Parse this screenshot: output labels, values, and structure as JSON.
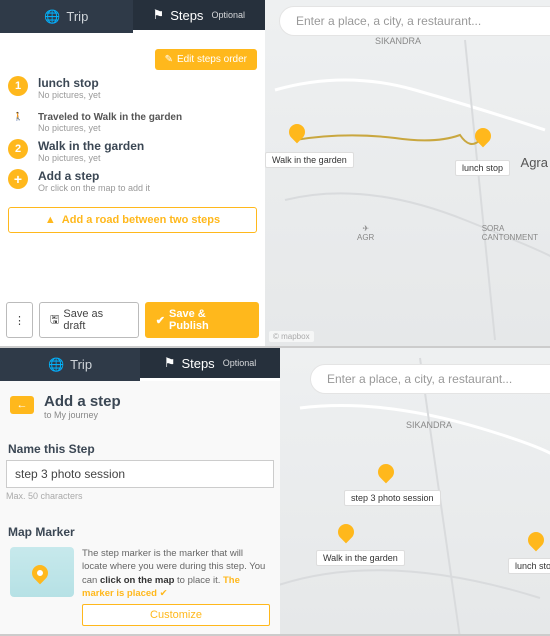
{
  "panel1": {
    "tabs": {
      "trip": "Trip",
      "steps": "Steps",
      "steps_suffix": "Optional"
    },
    "search_placeholder": "Enter a place, a city, a restaurant...",
    "edit_steps_order": "Edit steps order",
    "steps": [
      {
        "num": "1",
        "title": "lunch stop",
        "sub": "No pictures, yet"
      }
    ],
    "travel": {
      "label": "Traveled to Walk in the garden",
      "sub": "No pictures, yet"
    },
    "steps2": [
      {
        "num": "2",
        "title": "Walk in the garden",
        "sub": "No pictures, yet"
      }
    ],
    "add_step": {
      "title": "Add a step",
      "sub": "Or click on the map to add it"
    },
    "road_between": "Add a road between two steps",
    "actions": {
      "save_draft": "Save as draft",
      "publish": "Save & Publish"
    },
    "map": {
      "labels": {
        "sikandra": "SIKANDRA",
        "agra": "Agra",
        "agr": "AGR",
        "sora": "SORA\nCANTONMENT"
      },
      "pins": {
        "walk": "Walk in the garden",
        "lunch": "lunch stop"
      },
      "attrib": "© mapbox"
    }
  },
  "panel2": {
    "tabs": {
      "trip": "Trip",
      "steps": "Steps",
      "steps_suffix": "Optional"
    },
    "search_placeholder": "Enter a place, a city, a restaurant...",
    "header": {
      "title": "Add a step",
      "sub": "to My journey"
    },
    "name_label": "Name this Step",
    "name_value": "step 3 photo session",
    "name_hint": "Max. 50 characters",
    "marker_label": "Map Marker",
    "marker_desc_1": "The step marker is the marker that will locate where you were during this step. You can ",
    "marker_desc_bold": "click on the map",
    "marker_desc_2": " to place it. ",
    "marker_placed": "The marker is placed",
    "customize": "Customize",
    "map": {
      "labels": {
        "sikandra": "SIKANDRA"
      },
      "pins": {
        "step3": "step 3 photo session",
        "walk": "Walk in the garden",
        "lunch": "lunch stop"
      }
    }
  }
}
